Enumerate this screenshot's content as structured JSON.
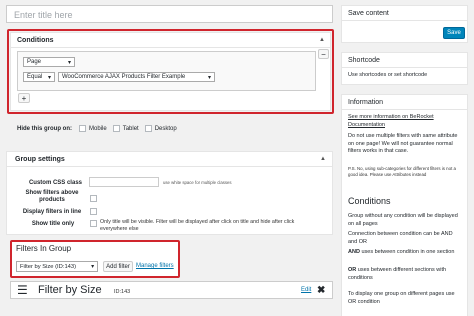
{
  "title_input": {
    "placeholder": "Enter title here"
  },
  "conditions": {
    "header": "Conditions",
    "row1_select": "Page",
    "row2_op": "Equal",
    "row2_value": "WooCommerce AJAX Products Filter Example",
    "add_label": "+",
    "remove_label": "−"
  },
  "hide_group": {
    "label": "Hide this group on:",
    "options": [
      "Mobile",
      "Tablet",
      "Desktop"
    ]
  },
  "group_settings": {
    "header": "Group settings",
    "custom_css_label": "Custom CSS class",
    "custom_css_hint": "use white space for multiple classes",
    "show_filters_above_label": "Show filters above products",
    "display_inline_label": "Display filters in line",
    "show_title_only_label": "Show title only",
    "show_title_only_desc": "Only title will be visible. Filter will be displayed after click on title and hide after click everywhere else"
  },
  "filters_in_group": {
    "header": "Filters In Group",
    "select_value": "Filter by Size (ID:143)",
    "add_button": "Add filter",
    "manage_link": "Manage filters"
  },
  "filter_item": {
    "title": "Filter by Size",
    "id_label": "ID:143",
    "edit_link": "Edit",
    "close_label": "✖"
  },
  "sidebar": {
    "save_content_header": "Save content",
    "save_button": "Save",
    "shortcode_header": "Shortcode",
    "shortcode_text": "Use shortcodes or set shortcode",
    "information_header": "Information",
    "info_link": "See more information on BeRocket Documentation",
    "info_warning": "Do not use multiple filters with same attribute on one page! We will not guarantee normal filters works in that case.",
    "info_ps": "P.S. No, using sub-categories for different filters is not a good idea. Please use Attributes instead",
    "conditions_title": "Conditions",
    "cond1": "Group without any condition will be displayed on all pages",
    "cond2": "Connection between condition can be AND and OR",
    "cond3_bold": "AND",
    "cond3": " uses between condition in one section",
    "cond4_bold": "OR",
    "cond4": " uses between different sections with conditions",
    "cond5": "To display one group on different pages use OR condition"
  }
}
